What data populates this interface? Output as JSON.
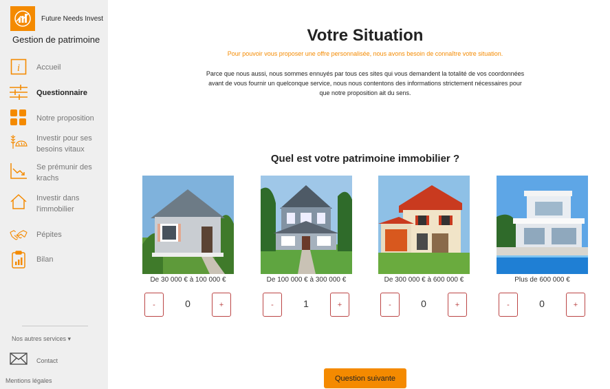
{
  "brand": {
    "name": "Future Needs Invest",
    "subtitle": "Gestion de patrimoine"
  },
  "nav": [
    {
      "label": "Accueil",
      "icon": "info-icon",
      "active": false
    },
    {
      "label": "Questionnaire",
      "icon": "sliders-icon",
      "active": true
    },
    {
      "label": "Notre proposition",
      "icon": "grid-icon",
      "active": false
    },
    {
      "label": "Investir pour ses besoins vitaux",
      "icon": "wheat-bread-icon",
      "active": false
    },
    {
      "label": "Se prémunir des krachs",
      "icon": "chart-down-icon",
      "active": false
    },
    {
      "label": "Investir dans l'immobilier",
      "icon": "house-icon",
      "active": false
    },
    {
      "label": "Pépites",
      "icon": "handshake-icon",
      "active": false
    },
    {
      "label": "Bilan",
      "icon": "clipboard-chart-icon",
      "active": false
    }
  ],
  "footer": {
    "other_services": "Nos autres services",
    "contact": "Contact",
    "legal": "Mentions légales"
  },
  "main": {
    "title": "Votre Situation",
    "highlight": "Pour pouvoir vous proposer une offre personnalisée, nous avons besoin de connaître votre situation.",
    "description": "Parce que nous aussi, nous sommes ennuyés par tous ces sites qui vous demandent la totalité de vos coordonnées avant de vous fournir un quelconque service, nous nous contentons des informations strictement nécessaires pour que notre proposition ait du sens.",
    "question": "Quel est votre patrimoine immobilier ?",
    "options": [
      {
        "label": "De 30 000 € à 100 000 €",
        "value": "0",
        "image": "small-cottage"
      },
      {
        "label": "De 100 000 € à 300 000 €",
        "value": "1",
        "image": "two-story-house"
      },
      {
        "label": "De 300 000 € à 600 000 €",
        "value": "0",
        "image": "villa-red-roof"
      },
      {
        "label": "Plus de 600 000 €",
        "value": "0",
        "image": "modern-villa-pool"
      }
    ],
    "minus_label": "-",
    "plus_label": "+",
    "next_button": "Question suivante"
  },
  "colors": {
    "accent": "#f48a00",
    "stepper_border": "#bb4444",
    "sidebar_bg": "#efefef"
  }
}
